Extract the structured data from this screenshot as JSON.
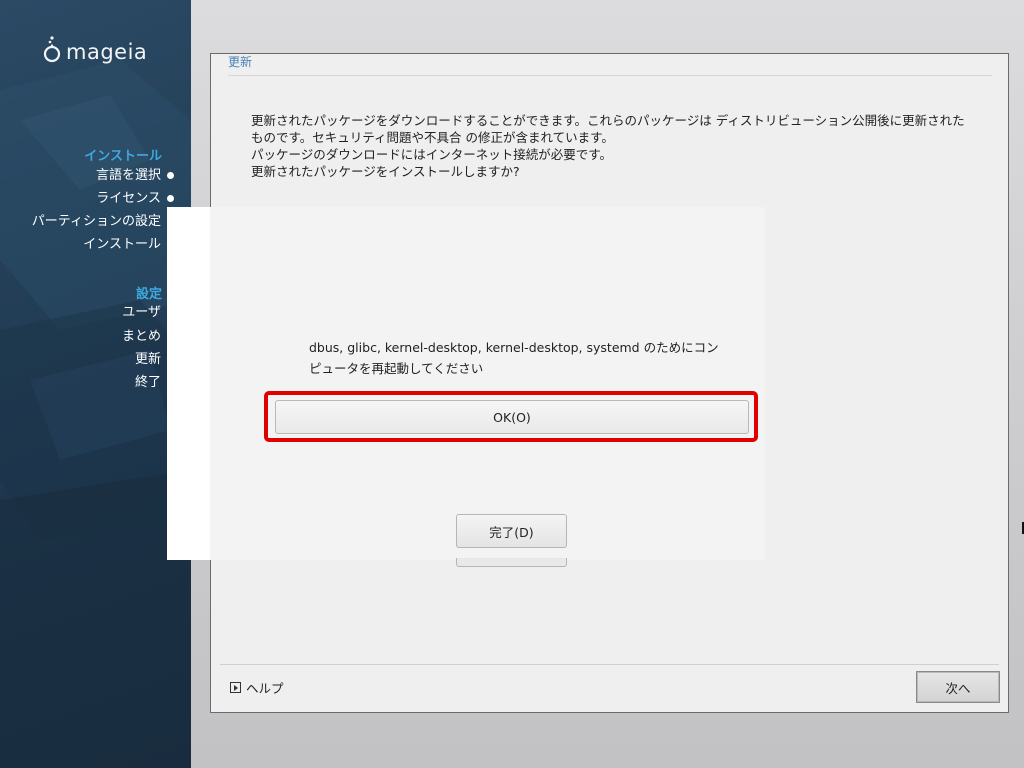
{
  "brand": {
    "logo_text": "mageia"
  },
  "sidebar": {
    "groups": [
      {
        "title": "インストール",
        "items": [
          {
            "label": "言語を選択",
            "done": true
          },
          {
            "label": "ライセンス",
            "done": true
          },
          {
            "label": "パーティションの設定",
            "done": true
          },
          {
            "label": "インストール",
            "done": true
          }
        ]
      },
      {
        "title": "設定",
        "items": [
          {
            "label": "ユーザ",
            "done": true
          },
          {
            "label": "まとめ",
            "done": true
          },
          {
            "label": "更新",
            "done": false
          },
          {
            "label": "終了",
            "done": false
          }
        ]
      }
    ]
  },
  "main": {
    "title": "更新",
    "description": [
      "更新されたパッケージをダウンロードすることができます。これらのパッケージは ディストリビューション公開後に更新された",
      "ものです。セキュリティ問題や不具合 の修正が含まれています。",
      "パッケージのダウンロードにはインターネット接続が必要です。",
      "更新されたパッケージをインストールしますか?"
    ],
    "help_label": "ヘルプ",
    "next_label": "次へ"
  },
  "dialog": {
    "message_lines": [
      "dbus, glibc, kernel-desktop, kernel-desktop, systemd のためにコン",
      "ピュータを再起動してください"
    ],
    "ok_label": "OK(O)",
    "done_label": "完了(D)"
  },
  "colors": {
    "accent": "#3da9e0",
    "highlight": "#e00000",
    "sidebar_bg": "#213b53",
    "title_link": "#4b7fb8"
  }
}
